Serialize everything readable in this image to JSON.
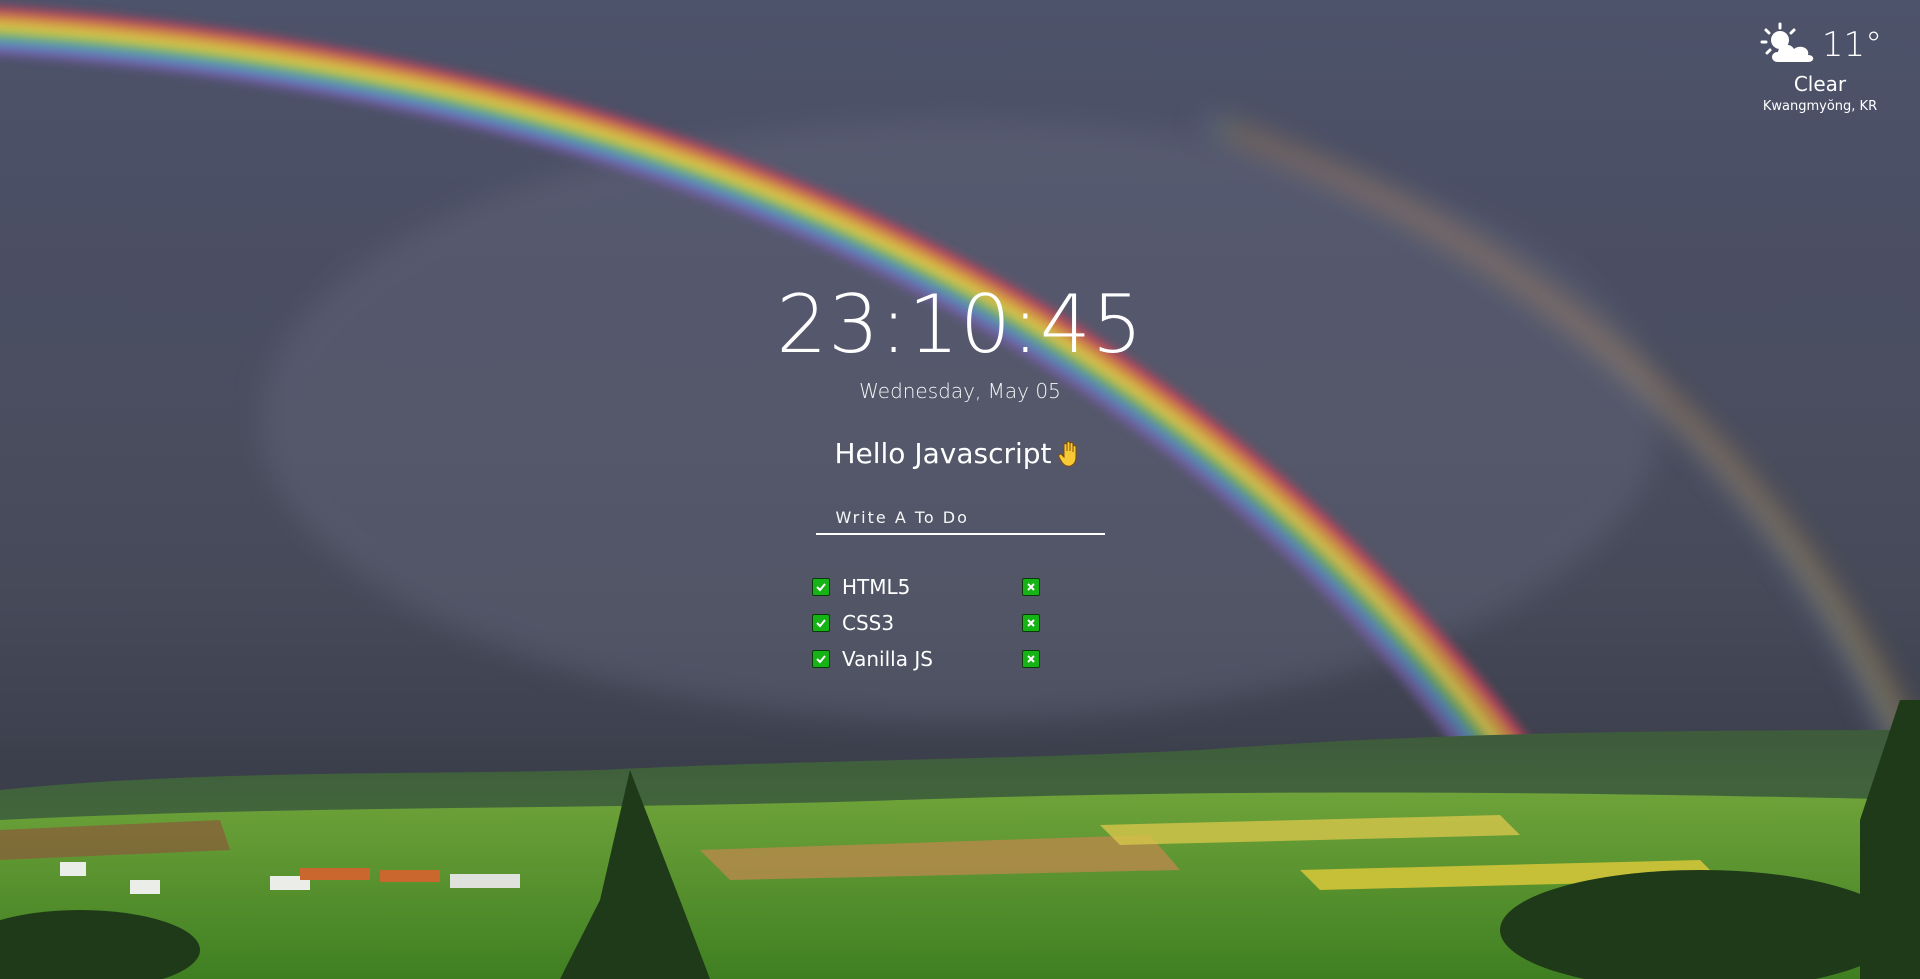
{
  "weather": {
    "temperature": "11°",
    "condition": "Clear",
    "location": "Kwangmyŏng, KR",
    "icon": "sun-behind-cloud-icon"
  },
  "clock": {
    "time": "23:10:45",
    "date": "Wednesday, May 05"
  },
  "greeting": {
    "text": "Hello Javascript",
    "icon": "waving-hand-icon"
  },
  "todo_input": {
    "placeholder": "Write A To Do"
  },
  "todos": [
    {
      "text": "HTML5",
      "checked": true
    },
    {
      "text": "CSS3",
      "checked": true
    },
    {
      "text": "Vanilla JS",
      "checked": true
    }
  ],
  "colors": {
    "checkbox_green": "#16b316",
    "text": "#ffffff",
    "sky": "#4b4f65"
  }
}
